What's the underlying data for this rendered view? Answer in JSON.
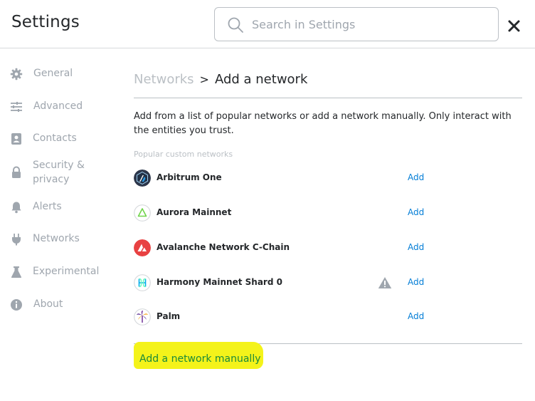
{
  "header": {
    "title": "Settings",
    "search_placeholder": "Search in Settings",
    "search_value": ""
  },
  "sidebar": {
    "items": [
      {
        "label": "General",
        "icon": "gear-icon"
      },
      {
        "label": "Advanced",
        "icon": "sliders-icon"
      },
      {
        "label": "Contacts",
        "icon": "contact-book-icon"
      },
      {
        "label": "Security &",
        "label2": "privacy",
        "icon": "lock-icon"
      },
      {
        "label": "Alerts",
        "icon": "bell-icon"
      },
      {
        "label": "Networks",
        "icon": "plug-icon"
      },
      {
        "label": "Experimental",
        "icon": "flask-icon"
      },
      {
        "label": "About",
        "icon": "info-icon"
      }
    ]
  },
  "main": {
    "breadcrumb": {
      "parent": "Networks",
      "separator": ">",
      "current": "Add a network"
    },
    "description": "Add from a list of popular networks or add a network manually. Only interact with the entities you trust.",
    "section_label": "Popular custom networks",
    "networks": [
      {
        "name": "Arbitrum One",
        "add_label": "Add",
        "icon": "arbitrum-logo-icon"
      },
      {
        "name": "Aurora Mainnet",
        "add_label": "Add",
        "icon": "aurora-logo-icon"
      },
      {
        "name": "Avalanche Network C-Chain",
        "add_label": "Add",
        "icon": "avalanche-logo-icon"
      },
      {
        "name": "Harmony Mainnet Shard 0",
        "add_label": "Add",
        "icon": "harmony-logo-icon",
        "warning": true
      },
      {
        "name": "Palm",
        "add_label": "Add",
        "icon": "palm-logo-icon"
      }
    ],
    "manual_link": "Add a network manually"
  },
  "colors": {
    "link": "#037dd6",
    "muted": "#9fa6ae",
    "highlight": "#f4f31a",
    "manual_link_text": "#1a8a3a",
    "avalanche_red": "#e84142"
  }
}
